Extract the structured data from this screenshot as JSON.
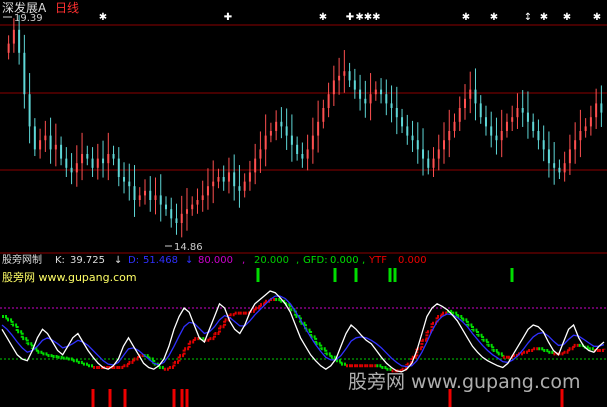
{
  "chart_data": [
    {
      "type": "candlestick",
      "title": "深发展A",
      "period": "日线",
      "price_high_label": "19.39",
      "price_low_label": "14.86",
      "ylim": [
        14.5,
        19.5
      ],
      "series": [
        {
          "name": "close",
          "values": [
            18.9,
            19.2,
            18.7,
            17.8,
            17.1,
            16.6,
            16.8,
            16.9,
            16.6,
            16.7,
            16.4,
            16.2,
            16.1,
            16.3,
            16.5,
            16.4,
            16.2,
            16.4,
            16.3,
            16.5,
            16.4,
            16.0,
            15.9,
            15.8,
            15.5,
            15.6,
            15.7,
            15.5,
            15.6,
            15.4,
            15.3,
            15.1,
            15.0,
            15.2,
            15.3,
            15.4,
            15.5,
            15.6,
            15.8,
            15.9,
            16.0,
            15.9,
            16.1,
            15.8,
            15.7,
            15.9,
            16.1,
            16.4,
            16.6,
            16.9,
            17.0,
            17.2,
            17.1,
            16.9,
            16.7,
            16.5,
            16.4,
            16.6,
            16.9,
            17.2,
            17.5,
            17.8,
            18.1,
            18.2,
            18.3,
            18.1,
            17.9,
            17.7,
            17.6,
            17.8,
            17.9,
            17.8,
            17.6,
            17.5,
            17.3,
            17.1,
            16.9,
            16.8,
            16.6,
            16.4,
            16.2,
            16.4,
            16.6,
            16.8,
            17.0,
            17.2,
            17.5,
            17.7,
            17.9,
            17.6,
            17.3,
            17.1,
            16.9,
            16.8,
            17.0,
            17.2,
            17.3,
            17.5,
            17.4,
            17.2,
            17.0,
            16.8,
            16.6,
            16.3,
            16.2,
            16.1,
            16.3,
            16.6,
            16.8,
            17.0,
            17.1,
            17.3,
            17.6,
            17.4
          ]
        }
      ],
      "markers": [
        {
          "symbol": "✱"
        },
        {
          "symbol": "✚"
        },
        {
          "symbol": "✱"
        },
        {
          "symbol": "✚"
        },
        {
          "symbol": "✱✱✱"
        },
        {
          "symbol": "✱"
        },
        {
          "symbol": "✱"
        },
        {
          "symbol": "↕"
        },
        {
          "symbol": "✱"
        },
        {
          "symbol": "✱"
        },
        {
          "symbol": "✱"
        }
      ]
    },
    {
      "type": "line",
      "title": "股旁网制",
      "subtitle": "股旁网 www.gupang.com",
      "watermark": "股旁网 www.gupang.com",
      "ylim": [
        0,
        100
      ],
      "reference_lines": [
        80,
        20
      ],
      "readout": [
        {
          "label": "K:",
          "value": "39.725",
          "arrow": "↓"
        },
        {
          "label": "D:",
          "value": "51.468",
          "arrow": "↓"
        },
        {
          "label": "",
          "value": "80.000"
        },
        {
          "label": "",
          "value": "20.000"
        },
        {
          "label": "GFD:",
          "value": "0.000"
        },
        {
          "label": "YTF",
          "value": "0.000"
        }
      ],
      "series": [
        {
          "name": "K",
          "color": "#ffffff",
          "values": [
            55,
            45,
            35,
            25,
            20,
            18,
            30,
            45,
            55,
            50,
            40,
            30,
            25,
            35,
            45,
            50,
            40,
            30,
            22,
            15,
            10,
            8,
            12,
            20,
            35,
            45,
            35,
            25,
            15,
            10,
            8,
            12,
            20,
            35,
            55,
            70,
            80,
            75,
            60,
            45,
            40,
            55,
            70,
            85,
            80,
            65,
            55,
            50,
            60,
            75,
            85,
            90,
            95,
            100,
            98,
            92,
            85,
            75,
            60,
            45,
            35,
            25,
            18,
            12,
            8,
            12,
            20,
            35,
            50,
            60,
            55,
            48,
            42,
            38,
            30,
            22,
            15,
            10,
            6,
            5,
            8,
            15,
            30,
            50,
            70,
            80,
            85,
            82,
            78,
            72,
            65,
            55,
            45,
            35,
            28,
            22,
            18,
            15,
            12,
            10,
            15,
            25,
            35,
            45,
            55,
            60,
            58,
            52,
            40,
            30,
            25,
            40,
            55,
            60,
            45,
            35,
            30,
            28,
            35,
            40
          ]
        },
        {
          "name": "D",
          "color": "#3030ff",
          "values": [
            60,
            55,
            48,
            40,
            33,
            28,
            30,
            35,
            42,
            45,
            42,
            38,
            33,
            35,
            38,
            42,
            40,
            36,
            30,
            24,
            18,
            14,
            13,
            16,
            24,
            32,
            33,
            30,
            25,
            20,
            15,
            13,
            16,
            24,
            35,
            47,
            58,
            63,
            62,
            56,
            50,
            52,
            58,
            66,
            71,
            69,
            64,
            59,
            59,
            65,
            72,
            78,
            84,
            90,
            94,
            94,
            91,
            85,
            76,
            66,
            56,
            46,
            37,
            29,
            22,
            19,
            19,
            24,
            32,
            41,
            45,
            46,
            45,
            42,
            38,
            33,
            27,
            21,
            16,
            12,
            11,
            12,
            18,
            28,
            40,
            53,
            64,
            70,
            73,
            72,
            69,
            64,
            58,
            50,
            43,
            36,
            30,
            25,
            21,
            17,
            16,
            19,
            24,
            31,
            39,
            46,
            50,
            51,
            47,
            41,
            36,
            37,
            43,
            48,
            47,
            43,
            39,
            35,
            35,
            37
          ]
        },
        {
          "name": "stair",
          "color": "#e00000",
          "alt_color": "#00dd00",
          "values": [
            70,
            66,
            60,
            52,
            44,
            38,
            32,
            28,
            26,
            24,
            23,
            22,
            21,
            20,
            18,
            16,
            14,
            12,
            10,
            10,
            10,
            10,
            10,
            10,
            12,
            16,
            20,
            24,
            24,
            20,
            14,
            10,
            8,
            10,
            16,
            24,
            32,
            40,
            44,
            44,
            42,
            44,
            50,
            58,
            66,
            72,
            74,
            74,
            74,
            76,
            80,
            84,
            88,
            90,
            90,
            88,
            84,
            78,
            70,
            62,
            54,
            46,
            38,
            32,
            26,
            22,
            18,
            14,
            12,
            12,
            12,
            12,
            12,
            12,
            12,
            10,
            8,
            6,
            6,
            8,
            14,
            22,
            32,
            42,
            52,
            62,
            70,
            74,
            76,
            74,
            70,
            66,
            60,
            54,
            48,
            42,
            36,
            30,
            26,
            22,
            22,
            24,
            26,
            28,
            30,
            32,
            32,
            30,
            28,
            26,
            26,
            28,
            32,
            36,
            36,
            34,
            32,
            30,
            30,
            32
          ],
          "rising_color": "#e00000",
          "falling_color": "#00dd00"
        }
      ]
    }
  ],
  "colors": {
    "background": "#000000",
    "grid_red": "#8b0000",
    "up_candle": "#ff5050",
    "down_candle": "#5fd7d7",
    "title": "#dddddd",
    "period": "#ff3030",
    "ref_line_80": "#cc00cc",
    "ref_line_20": "#00cc00",
    "signal_green": "#00dd00",
    "signal_red": "#ee0000",
    "watermark": "#cccccc"
  }
}
